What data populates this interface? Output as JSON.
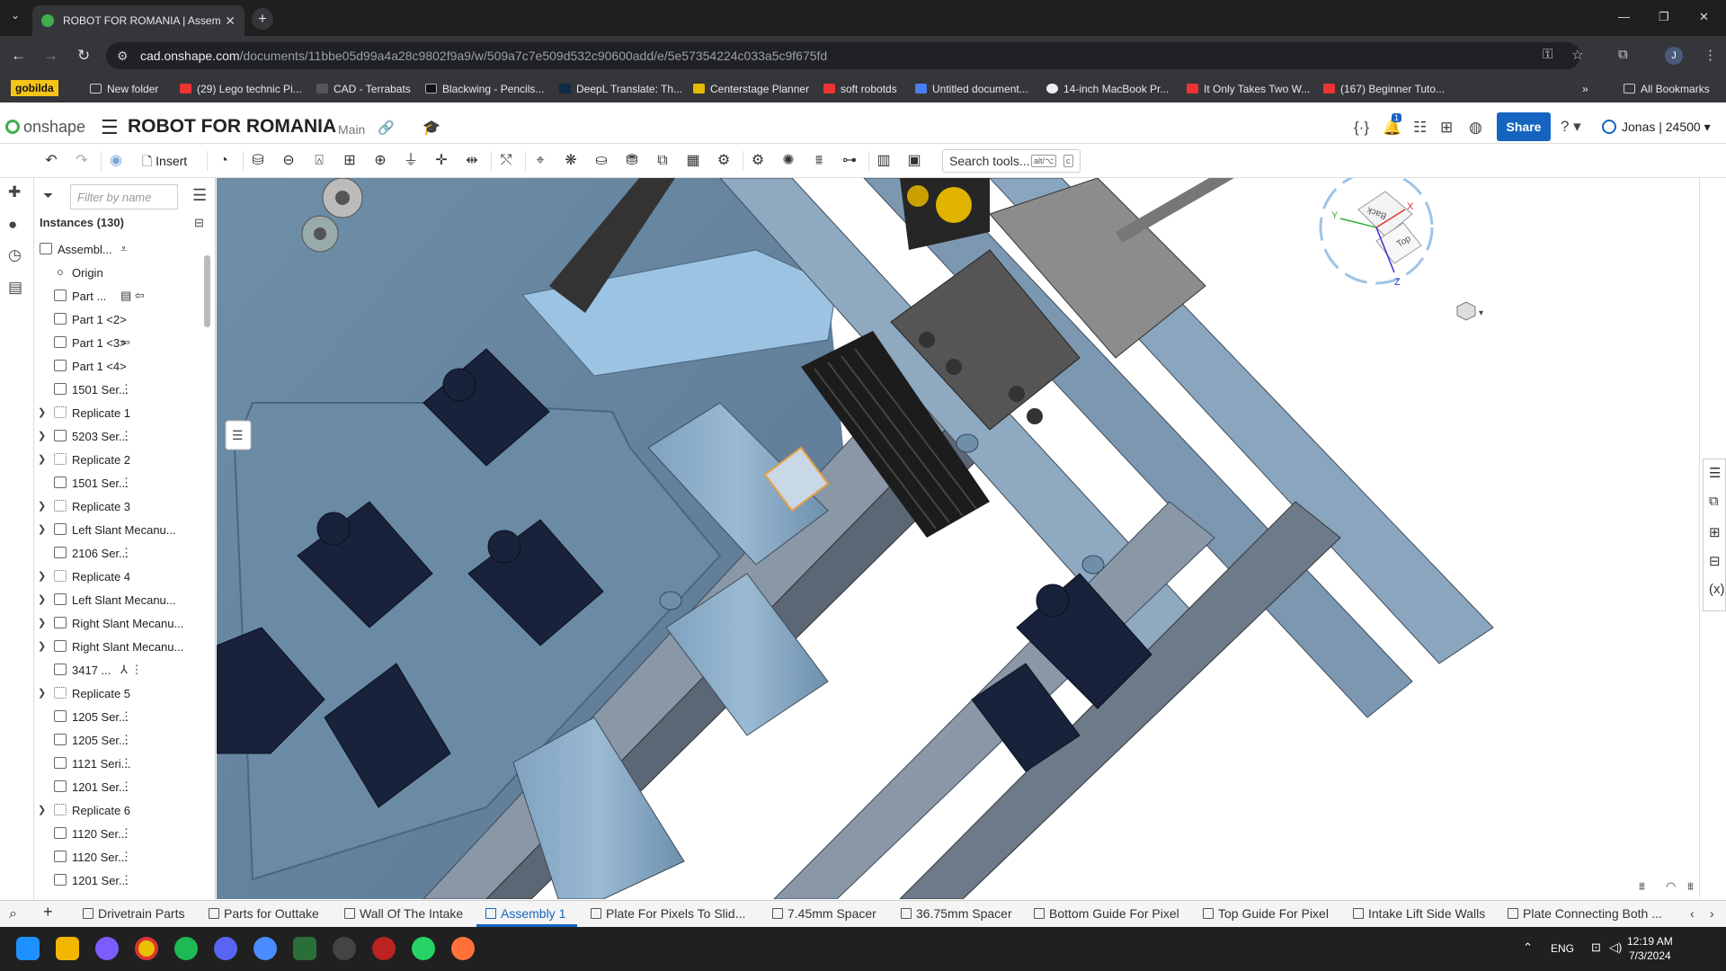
{
  "browser": {
    "tab_title": "ROBOT FOR ROMANIA | Assem",
    "url_host": "cad.onshape.com",
    "url_path": "/documents/11bbe05d99a4a28c9802f9a9/w/509a7c7e509d532c90600add/e/5e57354224c033a5c9f675fd",
    "avatar_letter": "J"
  },
  "bookmarks": [
    "gobilda",
    "New folder",
    "(29) Lego technic Pi...",
    "CAD - Terrabats",
    "Blackwing - Pencils...",
    "DeepL Translate: Th...",
    "Centerstage Planner",
    "soft robotds",
    "Untitled document...",
    "14-inch MacBook Pr...",
    "It Only Takes Two W...",
    "(167) Beginner Tuto...",
    "All Bookmarks"
  ],
  "onshape": {
    "logo_text": "onshape",
    "document_title": "ROBOT FOR ROMANIA",
    "branch": "Main",
    "notification_count": "1",
    "share_label": "Share",
    "user_label": "Jonas | 24500"
  },
  "toolbar": {
    "insert_label": "Insert",
    "search_placeholder": "Search tools...",
    "search_kbd1": "alt/⌥",
    "search_kbd2": "c"
  },
  "panel": {
    "filter_placeholder": "Filter by name",
    "instances_header": "Instances (130)",
    "items": [
      {
        "label": "Assembl...",
        "expandable": false,
        "indent": 0,
        "type": "assembly",
        "extra": "⩡"
      },
      {
        "label": "Origin",
        "expandable": false,
        "indent": 1,
        "type": "origin",
        "extra": ""
      },
      {
        "label": "Part ...",
        "expandable": false,
        "indent": 1,
        "type": "part",
        "extra": "▤ ⇦"
      },
      {
        "label": "Part 1 <2>",
        "expandable": false,
        "indent": 1,
        "type": "part",
        "extra": ""
      },
      {
        "label": "Part 1 <3>",
        "expandable": false,
        "indent": 1,
        "type": "part",
        "extra": "⇦"
      },
      {
        "label": "Part 1 <4>",
        "expandable": false,
        "indent": 1,
        "type": "part",
        "extra": ""
      },
      {
        "label": "1501 Ser...",
        "expandable": false,
        "indent": 1,
        "type": "part",
        "extra": "⋮"
      },
      {
        "label": "Replicate 1",
        "expandable": true,
        "indent": 1,
        "type": "replicate",
        "extra": ""
      },
      {
        "label": "5203 Ser...",
        "expandable": true,
        "indent": 1,
        "type": "assembly",
        "extra": "⋮"
      },
      {
        "label": "Replicate 2",
        "expandable": true,
        "indent": 1,
        "type": "replicate",
        "extra": ""
      },
      {
        "label": "1501 Ser...",
        "expandable": false,
        "indent": 1,
        "type": "part",
        "extra": "⋮"
      },
      {
        "label": "Replicate 3",
        "expandable": true,
        "indent": 1,
        "type": "replicate",
        "extra": ""
      },
      {
        "label": "Left Slant Mecanu...",
        "expandable": true,
        "indent": 1,
        "type": "assembly",
        "extra": ""
      },
      {
        "label": "2106 Ser...",
        "expandable": false,
        "indent": 1,
        "type": "part",
        "extra": "⋮"
      },
      {
        "label": "Replicate 4",
        "expandable": true,
        "indent": 1,
        "type": "replicate",
        "extra": ""
      },
      {
        "label": "Left Slant Mecanu...",
        "expandable": true,
        "indent": 1,
        "type": "assembly",
        "extra": ""
      },
      {
        "label": "Right Slant Mecanu...",
        "expandable": true,
        "indent": 1,
        "type": "assembly",
        "extra": ""
      },
      {
        "label": "Right Slant Mecanu...",
        "expandable": true,
        "indent": 1,
        "type": "assembly",
        "extra": ""
      },
      {
        "label": "3417 ...",
        "expandable": false,
        "indent": 1,
        "type": "part",
        "extra": "⅄ ⋮"
      },
      {
        "label": "Replicate 5",
        "expandable": true,
        "indent": 1,
        "type": "replicate",
        "extra": ""
      },
      {
        "label": "1205 Ser...",
        "expandable": false,
        "indent": 1,
        "type": "part",
        "extra": "⋮"
      },
      {
        "label": "1205 Ser...",
        "expandable": false,
        "indent": 1,
        "type": "part",
        "extra": "⋮"
      },
      {
        "label": "1121 Seri...",
        "expandable": false,
        "indent": 1,
        "type": "assembly",
        "extra": "⋮"
      },
      {
        "label": "1201 Ser...",
        "expandable": false,
        "indent": 1,
        "type": "part",
        "extra": "⋮"
      },
      {
        "label": "Replicate 6",
        "expandable": true,
        "indent": 1,
        "type": "replicate",
        "extra": ""
      },
      {
        "label": "1120 Ser...",
        "expandable": false,
        "indent": 1,
        "type": "assembly",
        "extra": "⋮"
      },
      {
        "label": "1120 Ser...",
        "expandable": false,
        "indent": 1,
        "type": "assembly",
        "extra": "⋮"
      },
      {
        "label": "1201 Ser...",
        "expandable": false,
        "indent": 1,
        "type": "part",
        "extra": "⋮"
      }
    ]
  },
  "view_cube": {
    "face_back": "Back",
    "face_top": "Top",
    "axis_x": "X",
    "axis_y": "Y",
    "axis_z": "Z"
  },
  "bottom_tabs": [
    {
      "label": "Drivetrain Parts",
      "active": false,
      "icon": "folder"
    },
    {
      "label": "Parts for Outtake",
      "active": false,
      "icon": "folder"
    },
    {
      "label": "Wall Of The Intake",
      "active": false,
      "icon": "part-studio"
    },
    {
      "label": "Assembly 1",
      "active": true,
      "icon": "assembly"
    },
    {
      "label": "Plate For Pixels To Slid...",
      "active": false,
      "icon": "part-studio"
    },
    {
      "label": "7.45mm Spacer",
      "active": false,
      "icon": "part-studio"
    },
    {
      "label": "36.75mm Spacer",
      "active": false,
      "icon": "part-studio"
    },
    {
      "label": "Bottom Guide For Pixel",
      "active": false,
      "icon": "part-studio"
    },
    {
      "label": "Top Guide For Pixel",
      "active": false,
      "icon": "part-studio"
    },
    {
      "label": "Intake Lift Side Walls",
      "active": false,
      "icon": "part-studio"
    },
    {
      "label": "Plate Connecting Both ...",
      "active": false,
      "icon": "part-studio"
    }
  ],
  "taskbar": {
    "lang": "ENG",
    "time": "12:19 AM",
    "date": "7/3/2024"
  }
}
